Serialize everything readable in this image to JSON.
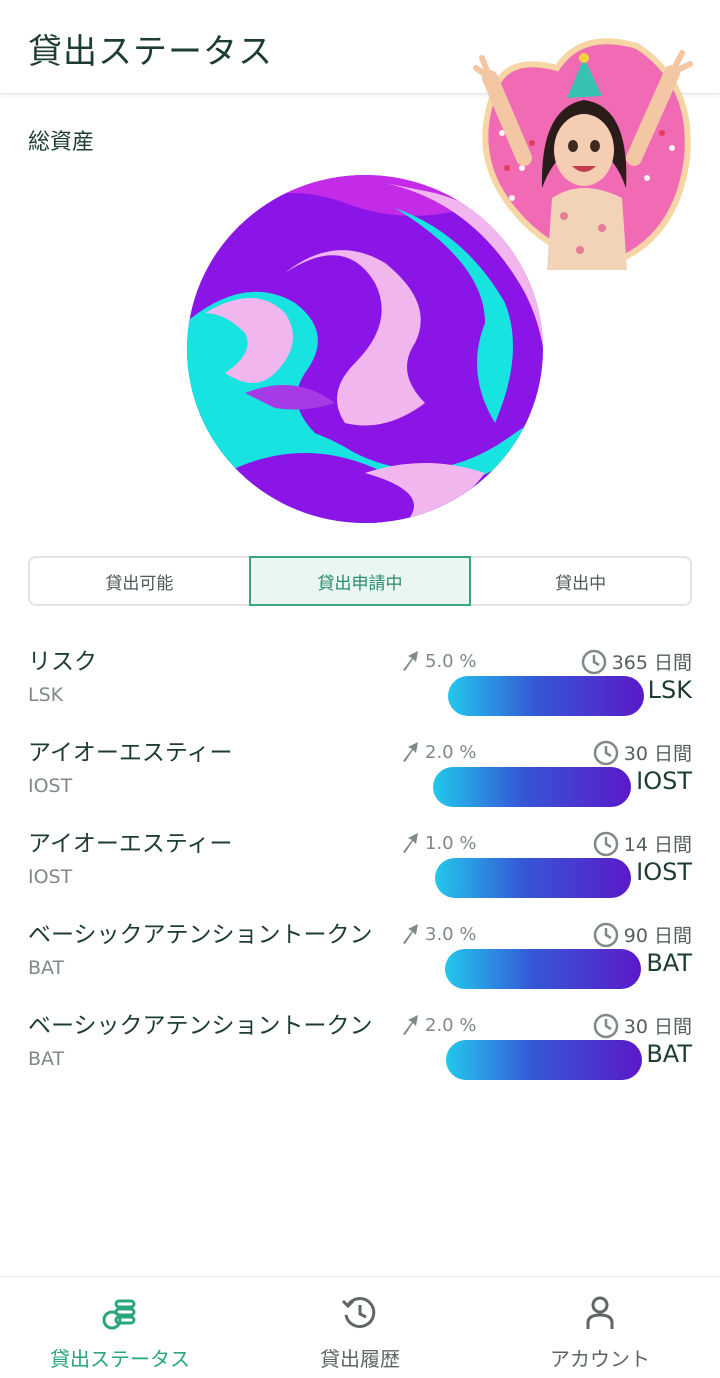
{
  "header": {
    "title": "貸出ステータス"
  },
  "assets": {
    "label": "総資産"
  },
  "tabs": [
    {
      "label": "貸出可能",
      "active": false
    },
    {
      "label": "貸出申請中",
      "active": true
    },
    {
      "label": "貸出中",
      "active": false
    }
  ],
  "loans": [
    {
      "name": "リスク",
      "symbol": "LSK",
      "rate": "5.0 %",
      "term": "365 日間",
      "unit": "LSK"
    },
    {
      "name": "アイオーエスティー",
      "symbol": "IOST",
      "rate": "2.0 %",
      "term": "30 日間",
      "unit": "IOST"
    },
    {
      "name": "アイオーエスティー",
      "symbol": "IOST",
      "rate": "1.0 %",
      "term": "14 日間",
      "unit": "IOST"
    },
    {
      "name": "ベーシックアテンショントークン",
      "symbol": "BAT",
      "rate": "3.0 %",
      "term": "90 日間",
      "unit": "BAT"
    },
    {
      "name": "ベーシックアテンショントークン",
      "symbol": "BAT",
      "rate": "2.0 %",
      "term": "30 日間",
      "unit": "BAT"
    }
  ],
  "bottom_nav": [
    {
      "label": "貸出ステータス",
      "icon": "coins-stack-icon",
      "active": true
    },
    {
      "label": "貸出履歴",
      "icon": "history-clock-icon",
      "active": false
    },
    {
      "label": "アカウント",
      "icon": "person-icon",
      "active": false
    }
  ],
  "colors": {
    "accent": "#29a77b",
    "bar_start": "#22c8ec",
    "bar_end": "#5b19c9"
  }
}
